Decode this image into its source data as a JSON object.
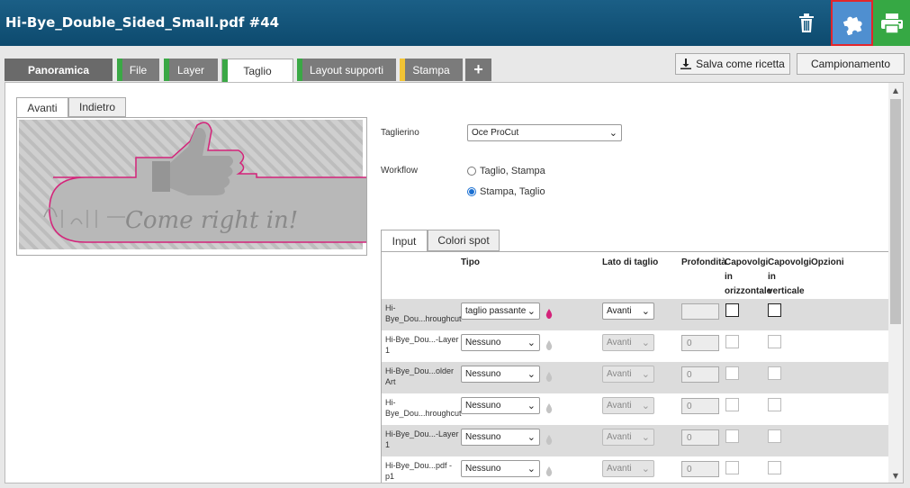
{
  "header": {
    "title": "Hi-Bye_Double_Sided_Small.pdf #44"
  },
  "tabs": [
    {
      "label": "Panoramica",
      "color": ""
    },
    {
      "label": "File",
      "color": "#3aa845"
    },
    {
      "label": "Layer",
      "color": "#3aa845"
    },
    {
      "label": "Taglio",
      "color": "#3aa845",
      "active": true
    },
    {
      "label": "Layout supporti",
      "color": "#3aa845"
    },
    {
      "label": "Stampa",
      "color": "#f2c434"
    },
    {
      "label": "+"
    }
  ],
  "toolbar": {
    "save_label": "Salva come ricetta",
    "sample_label": "Campionamento"
  },
  "preview": {
    "tab_front": "Avanti",
    "tab_back": "Indietro",
    "image_text": "Come right in!"
  },
  "form": {
    "cutter_label": "Taglierino",
    "cutter_value": "Oce ProCut",
    "workflow_label": "Workflow",
    "workflow_options": [
      "Taglio, Stampa",
      "Stampa, Taglio"
    ],
    "workflow_selected": "Stampa, Taglio"
  },
  "inner_tabs": {
    "input": "Input",
    "spot": "Colori spot"
  },
  "table": {
    "headers": {
      "tipo": "Tipo",
      "lato": "Lato di taglio",
      "prof": "Profondità",
      "cap_h": "Capovolgi in orizzontale",
      "cap_v": "Capovolgi in verticale",
      "opz": "Opzioni"
    },
    "rows": [
      {
        "name": "Hi-Bye_Dou...hroughcut",
        "tipo": "taglio passante",
        "lato": "Avanti",
        "depth": "",
        "active": true
      },
      {
        "name": "Hi-Bye_Dou...-Layer 1",
        "tipo": "Nessuno",
        "lato": "Avanti",
        "depth": "0",
        "active": false
      },
      {
        "name": "Hi-Bye_Dou...older Art",
        "tipo": "Nessuno",
        "lato": "Avanti",
        "depth": "0",
        "active": false
      },
      {
        "name": "Hi-Bye_Dou...hroughcut",
        "tipo": "Nessuno",
        "lato": "Avanti",
        "depth": "0",
        "active": false
      },
      {
        "name": "Hi-Bye_Dou...-Layer 1",
        "tipo": "Nessuno",
        "lato": "Avanti",
        "depth": "0",
        "active": false
      },
      {
        "name": "Hi-Bye_Dou...pdf - p1",
        "tipo": "Nessuno",
        "lato": "Avanti",
        "depth": "0",
        "active": false
      }
    ]
  },
  "colors": {
    "header_bg": "#155a80",
    "accent_blue": "#4f8fd0",
    "accent_green": "#36a844",
    "highlight_red": "#e3262b",
    "magenta": "#d4237a"
  }
}
